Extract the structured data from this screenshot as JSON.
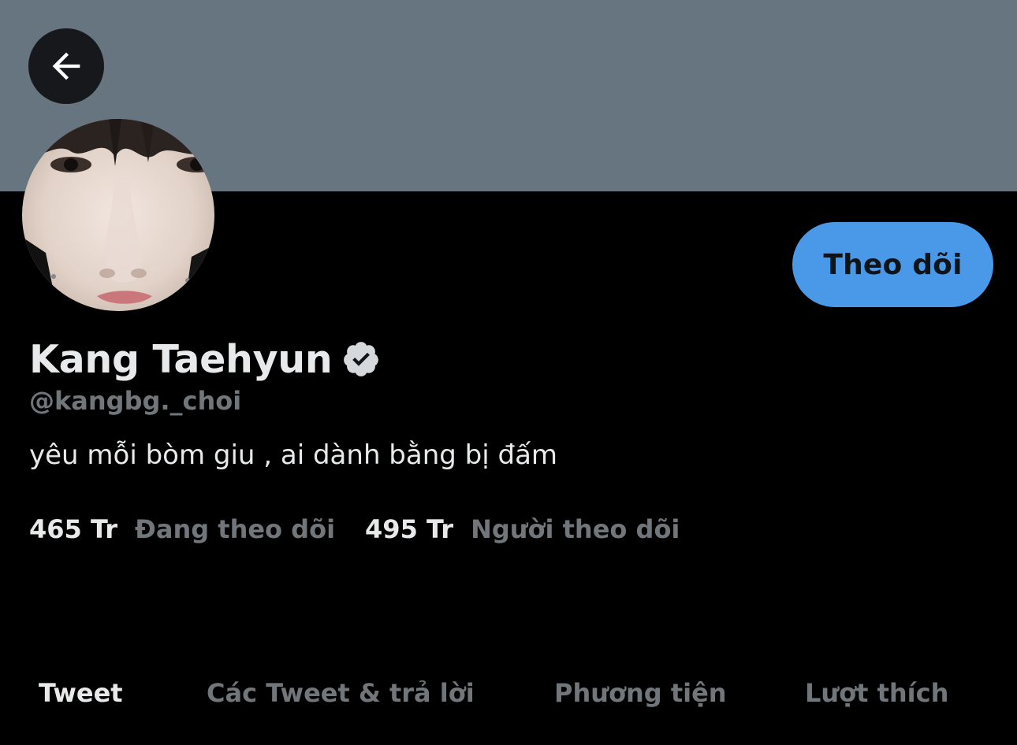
{
  "colors": {
    "banner": "#66757f",
    "background": "#000000",
    "follow_button_bg": "#4a99e9",
    "secondary_text": "#71767b",
    "primary_text": "#e7e9ea"
  },
  "header": {
    "back_icon": "arrow-left-icon"
  },
  "profile": {
    "avatar_icon": "profile-photo",
    "follow_label": "Theo dõi",
    "display_name": "Kang Taehyun",
    "verified_icon": "verified-badge-icon",
    "handle": "@kangbg._choi",
    "bio": "yêu mỗi bòm giu , ai dành bằng bị đấm",
    "following_count": "465 Tr",
    "following_label": "Đang theo dõi",
    "followers_count": "495 Tr",
    "followers_label": "Người theo dõi"
  },
  "tabs": [
    {
      "label": "Tweet",
      "active": true
    },
    {
      "label": "Các Tweet & trả lời",
      "active": false
    },
    {
      "label": "Phương tiện",
      "active": false
    },
    {
      "label": "Lượt thích",
      "active": false
    }
  ]
}
